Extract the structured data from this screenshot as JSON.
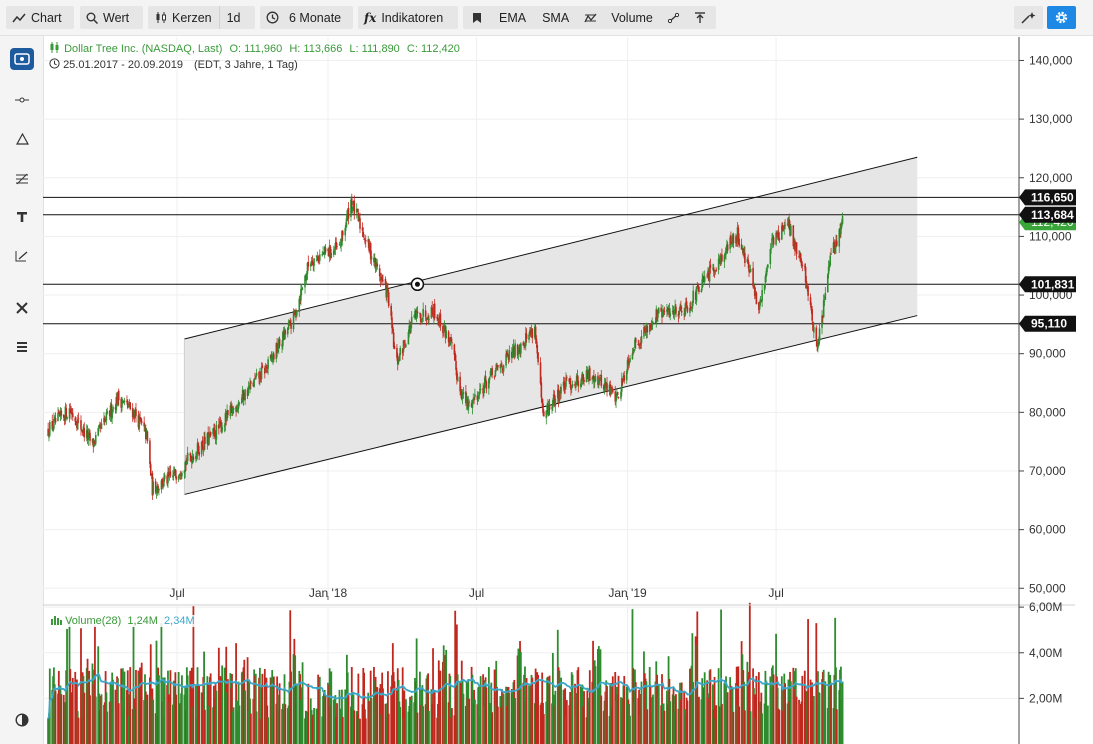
{
  "toolbar": {
    "chart": "Chart",
    "value": "Wert",
    "candles": "Kerzen",
    "interval": "1d",
    "range": "6 Monate",
    "indicators": "Indikatoren",
    "ema": "EMA",
    "sma": "SMA",
    "volume": "Volume"
  },
  "sidebar": {
    "tools": [
      "chart-type-icon",
      "crosshair-icon",
      "triangle-icon",
      "fib-icon",
      "text-icon",
      "pen-icon",
      "tools-icon",
      "layers-icon",
      "theme-icon"
    ]
  },
  "legend": {
    "name": "Dollar Tree Inc. (NASDAQ, Last)",
    "open_label": "O:",
    "open": "111,960",
    "high_label": "H:",
    "high": "113,666",
    "low_label": "L:",
    "low": "111,890",
    "close_label": "C:",
    "close": "112,420",
    "date_range": "25.01.2017 - 20.09.2019",
    "info": "(EDT, 3 Jahre, 1 Tag)",
    "volume_label": "Volume(28)",
    "volume_last": "1,24M",
    "volume_avg": "2,34M"
  },
  "colors": {
    "up": "#2e8b2e",
    "down": "#c0281e",
    "avg": "#3ba6c8",
    "channel": "#e3e3e3",
    "accent": "#1e88e5",
    "last": "#3aa63a"
  },
  "chart_data": [
    {
      "type": "candlestick",
      "title": "Dollar Tree Inc. (NASDAQ, Last)",
      "yticks": [
        "140,000",
        "130,000",
        "120,000",
        "110,000",
        "100,000",
        "90,000",
        "80,000",
        "70,000",
        "60,000",
        "50,000"
      ],
      "ylim": [
        48000,
        144000
      ],
      "xticks": [
        {
          "label": "Jul",
          "date": "2017-07-01"
        },
        {
          "label": "Jan '18",
          "date": "2018-01-01"
        },
        {
          "label": "Jul",
          "date": "2018-07-01"
        },
        {
          "label": "Jan '19",
          "date": "2019-01-01"
        },
        {
          "label": "Jul",
          "date": "2019-07-01"
        }
      ],
      "price_path": [
        [
          "2017-01-25",
          77000
        ],
        [
          "2017-02-20",
          80500
        ],
        [
          "2017-03-20",
          74500
        ],
        [
          "2017-04-20",
          82500
        ],
        [
          "2017-05-10",
          80000
        ],
        [
          "2017-05-25",
          76000
        ],
        [
          "2017-06-01",
          67000
        ],
        [
          "2017-06-25",
          69000
        ],
        [
          "2017-07-25",
          73500
        ],
        [
          "2017-08-20",
          77000
        ],
        [
          "2017-09-15",
          82000
        ],
        [
          "2017-10-20",
          88000
        ],
        [
          "2017-11-20",
          96000
        ],
        [
          "2017-12-10",
          106000
        ],
        [
          "2018-01-15",
          108000
        ],
        [
          "2018-01-29",
          116000
        ],
        [
          "2018-02-20",
          108000
        ],
        [
          "2018-03-15",
          100000
        ],
        [
          "2018-03-25",
          88000
        ],
        [
          "2018-04-15",
          96000
        ],
        [
          "2018-05-10",
          97500
        ],
        [
          "2018-05-30",
          92000
        ],
        [
          "2018-06-10",
          84500
        ],
        [
          "2018-06-20",
          81000
        ],
        [
          "2018-07-15",
          85500
        ],
        [
          "2018-08-20",
          91000
        ],
        [
          "2018-09-10",
          94500
        ],
        [
          "2018-09-20",
          79000
        ],
        [
          "2018-10-15",
          84500
        ],
        [
          "2018-11-20",
          86500
        ],
        [
          "2018-12-20",
          82500
        ],
        [
          "2019-01-05",
          90500
        ],
        [
          "2019-02-05",
          96500
        ],
        [
          "2019-03-15",
          98000
        ],
        [
          "2019-04-15",
          104500
        ],
        [
          "2019-05-15",
          110500
        ],
        [
          "2019-05-30",
          104000
        ],
        [
          "2019-06-10",
          97000
        ],
        [
          "2019-06-25",
          109000
        ],
        [
          "2019-07-15",
          112000
        ],
        [
          "2019-08-05",
          104000
        ],
        [
          "2019-08-20",
          90500
        ],
        [
          "2019-09-05",
          106000
        ],
        [
          "2019-09-20",
          112420
        ]
      ],
      "horizontal_lines": [
        {
          "label": "116,650",
          "value": 116650
        },
        {
          "label": "113,684",
          "value": 113684
        },
        {
          "label": "101,831",
          "value": 101831
        },
        {
          "label": "95,110",
          "value": 95110
        }
      ],
      "last_price": {
        "label": "112,420",
        "value": 112420
      },
      "channel": {
        "start": "2017-07-10",
        "end": "2019-12-20",
        "upper": [
          92500,
          123500
        ],
        "lower": [
          66000,
          96500
        ]
      },
      "marker": {
        "date": "2018-04-20",
        "value": 101831
      }
    },
    {
      "type": "bar",
      "title": "Volume(28)",
      "yticks": [
        "6,00M",
        "4,00M",
        "2,00M"
      ],
      "ylim": [
        0,
        6400000
      ],
      "moving_average_period": 28,
      "last": "1,24M",
      "average": "2,34M"
    }
  ]
}
